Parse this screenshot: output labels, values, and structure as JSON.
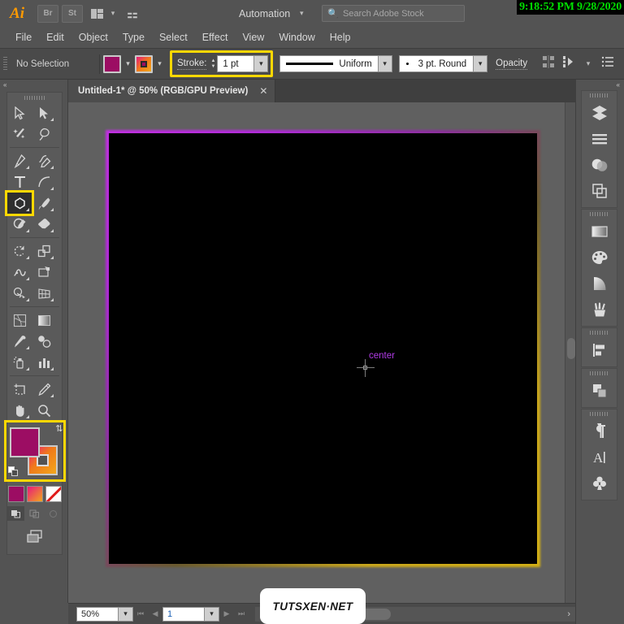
{
  "app": {
    "logo": "Ai",
    "bridge_label": "Br",
    "stock_label": "St",
    "arrange_icon": "arrange-icon",
    "rocket_icon": "discover-icon",
    "workspace": "Automation",
    "search_placeholder": "Search Adobe Stock",
    "search_icon": "search-icon",
    "timestamp": "9:18:52 PM 9/28/2020"
  },
  "menu": {
    "items": [
      "File",
      "Edit",
      "Object",
      "Type",
      "Select",
      "Effect",
      "View",
      "Window",
      "Help"
    ]
  },
  "control_bar": {
    "selection_status": "No Selection",
    "fill_color": "#9c0d63",
    "stroke_gradient_from": "#e8187d",
    "stroke_gradient_to": "#f2a81c",
    "stroke_label": "Stroke:",
    "stroke_weight": "1 pt",
    "stroke_profile": "Uniform",
    "brush_definition": "3 pt. Round",
    "opacity_label": "Opacity",
    "align_icon": "align-icon",
    "distribute_icon": "distribute-icon",
    "options_icon": "options-list-icon"
  },
  "toolbar": {
    "collapse_icon": "collapse-left-icon",
    "tools": [
      {
        "name": "selection-tool",
        "sub": false
      },
      {
        "name": "direct-selection-tool",
        "sub": true
      },
      {
        "name": "magic-wand-tool",
        "sub": false
      },
      {
        "name": "lasso-tool",
        "sub": false
      },
      {
        "name": "pen-tool",
        "sub": true
      },
      {
        "name": "curvature-tool",
        "sub": true
      },
      {
        "name": "type-tool",
        "sub": false
      },
      {
        "name": "line-segment-tool",
        "sub": true
      },
      {
        "name": "shape-tool",
        "sub": true,
        "selected": true
      },
      {
        "name": "paintbrush-tool",
        "sub": true
      },
      {
        "name": "shaper-tool",
        "sub": true
      },
      {
        "name": "eraser-tool",
        "sub": true
      },
      {
        "name": "rotate-tool",
        "sub": true
      },
      {
        "name": "scale-tool",
        "sub": true
      },
      {
        "name": "width-tool",
        "sub": true
      },
      {
        "name": "free-transform-tool",
        "sub": false
      },
      {
        "name": "shape-builder-tool",
        "sub": true
      },
      {
        "name": "perspective-grid-tool",
        "sub": true
      },
      {
        "name": "mesh-tool",
        "sub": false
      },
      {
        "name": "gradient-tool",
        "sub": false
      },
      {
        "name": "eyedropper-tool",
        "sub": true
      },
      {
        "name": "blend-tool",
        "sub": false
      },
      {
        "name": "symbol-sprayer-tool",
        "sub": true
      },
      {
        "name": "column-graph-tool",
        "sub": true
      },
      {
        "name": "artboard-tool",
        "sub": false
      },
      {
        "name": "slice-tool",
        "sub": true
      },
      {
        "name": "hand-tool",
        "sub": true
      },
      {
        "name": "zoom-tool",
        "sub": false
      }
    ],
    "fill_color": "#9c0d63",
    "stroke_gradient_from": "#e8187d",
    "stroke_gradient_to": "#f2a81c",
    "swap_icon": "swap-fill-stroke-icon",
    "default_icon": "default-fill-stroke-icon",
    "color_mode_icon": "color-swatch-icon",
    "gradient_mode_icon": "gradient-swatch-icon",
    "none_mode_icon": "none-swatch-icon",
    "draw_normal_icon": "draw-normal-icon",
    "draw_behind_icon": "draw-behind-icon",
    "draw_inside_icon": "draw-inside-icon",
    "screen_mode_icon": "screen-mode-icon"
  },
  "document": {
    "tab_title": "Untitled-1* @ 50% (RGB/GPU Preview)",
    "close_icon": "close-tab-icon"
  },
  "canvas": {
    "artboard_fill": "#000000",
    "border_gradient_from": "#c02fe0",
    "border_gradient_to": "#d4b013",
    "smart_guide_label": "center",
    "smart_guide_color": "#b23ce8",
    "cursor_icon": "crosshair-cursor-icon",
    "vertical_scrollbar": "vertical-scrollbar"
  },
  "right_panel": {
    "collapse_icon": "collapse-right-icon",
    "groups": [
      [
        "layers-panel-icon",
        "properties-panel-icon",
        "appearance-panel-icon",
        "pathfinder-panel-icon"
      ],
      [
        "gradient-panel-icon",
        "color-panel-icon",
        "transparency-panel-icon",
        "brushes-panel-icon"
      ],
      [
        "align-panel-icon"
      ],
      [
        "layers-stack-icon"
      ],
      [
        "paragraph-panel-icon",
        "character-panel-icon",
        "symbols-panel-icon"
      ]
    ]
  },
  "status_bar": {
    "zoom_level": "50%",
    "zoom_dropdown_icon": "chevron-down-icon",
    "first_page_icon": "first-artboard-icon",
    "prev_page_icon": "prev-artboard-icon",
    "page_number": "1",
    "page_dropdown_icon": "chevron-down-icon",
    "next_page_icon": "next-artboard-icon",
    "last_page_icon": "last-artboard-icon",
    "scroll_left_icon": "scroll-left-icon",
    "scroll_right_icon": "scroll-right-icon"
  },
  "watermark": {
    "text": "TUTSXEN·NET"
  }
}
